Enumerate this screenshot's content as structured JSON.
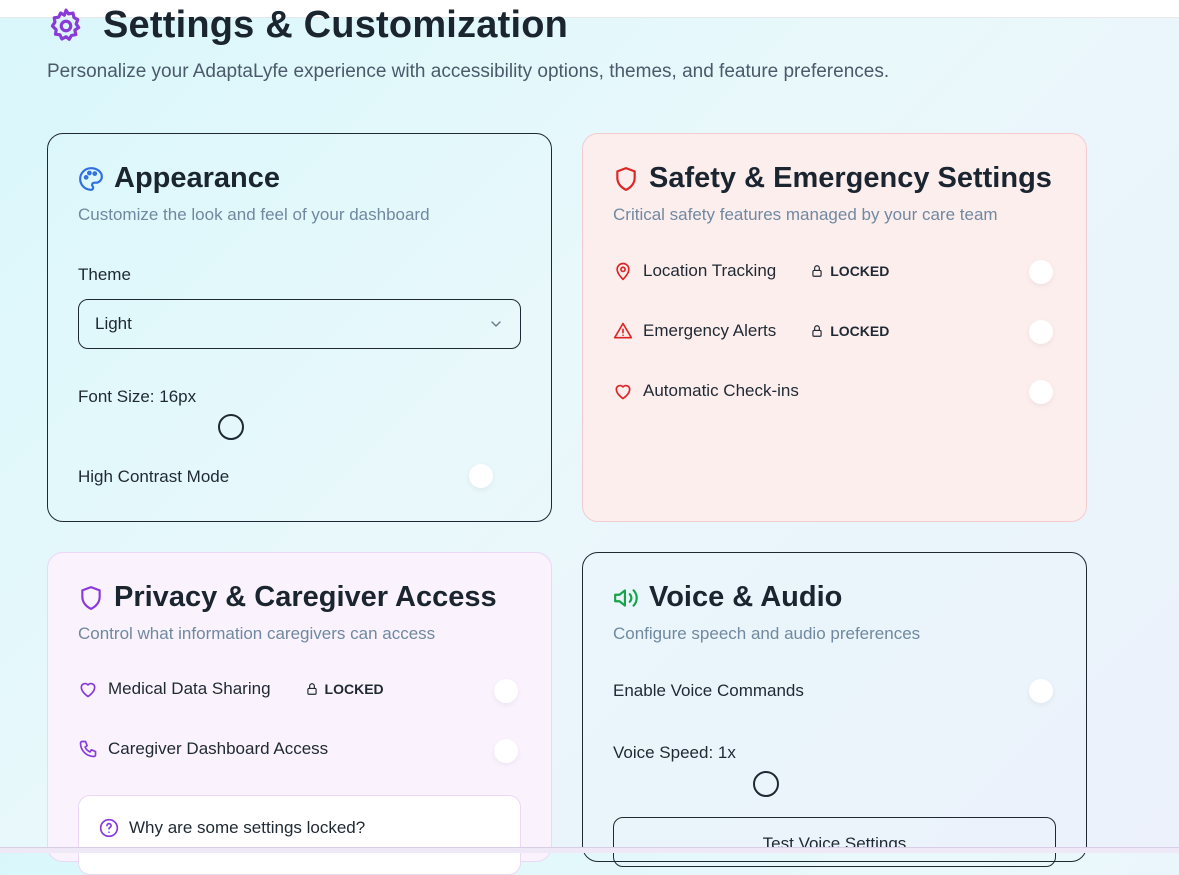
{
  "page": {
    "title": "Settings & Customization",
    "subtitle": "Personalize your AdaptaLyfe experience with accessibility options, themes, and feature preferences."
  },
  "appearance": {
    "title": "Appearance",
    "subtitle": "Customize the look and feel of your dashboard",
    "theme_label": "Theme",
    "theme_value": "Light",
    "font_size_label": "Font Size: 16px",
    "high_contrast_label": "High Contrast Mode"
  },
  "safety": {
    "title": "Safety & Emergency Settings",
    "subtitle": "Critical safety features managed by your care team",
    "items": [
      {
        "label": "Location Tracking",
        "locked": "LOCKED",
        "icon": "map-pin-icon"
      },
      {
        "label": "Emergency Alerts",
        "locked": "LOCKED",
        "icon": "alert-triangle-icon"
      },
      {
        "label": "Automatic Check-ins",
        "icon": "heart-icon"
      }
    ]
  },
  "privacy": {
    "title": "Privacy & Caregiver Access",
    "subtitle": "Control what information caregivers can access",
    "items": [
      {
        "label": "Medical Data Sharing",
        "locked": "LOCKED",
        "icon": "heart-icon"
      },
      {
        "label": "Caregiver Dashboard Access",
        "icon": "phone-icon"
      }
    ],
    "help_text": "Why are some settings locked?"
  },
  "voice": {
    "title": "Voice & Audio",
    "subtitle": "Configure speech and audio preferences",
    "enable_label": "Enable Voice Commands",
    "speed_label": "Voice Speed: 1x",
    "test_button": "Test Voice Settings"
  },
  "colors": {
    "purple": "#8a3ad8",
    "blue": "#2f6fe0",
    "red": "#dc2626",
    "green": "#16a34a"
  }
}
